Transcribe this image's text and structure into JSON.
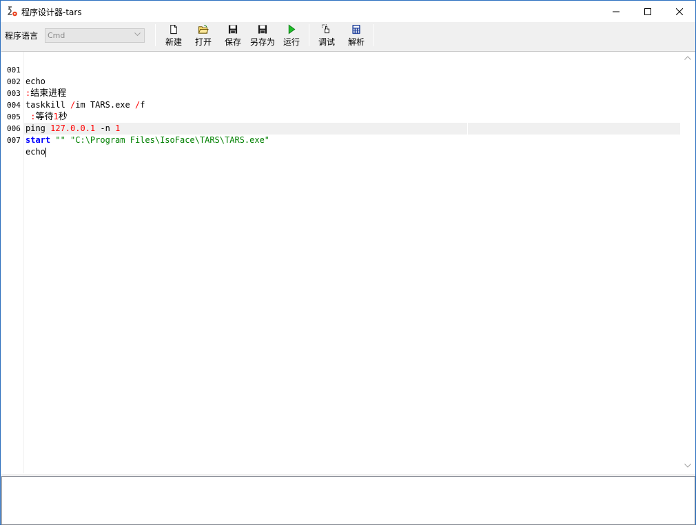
{
  "window": {
    "title": "程序设计器-tars",
    "app_icon": "gear-flow-icon",
    "controls": {
      "minimize": "minimize-icon",
      "maximize": "maximize-icon",
      "close": "close-icon"
    }
  },
  "toolbar": {
    "lang_label": "程序语言",
    "lang_value": "Cmd",
    "buttons": [
      {
        "label": "新建",
        "icon": "new-file-icon"
      },
      {
        "label": "打开",
        "icon": "open-folder-icon"
      },
      {
        "label": "保存",
        "icon": "save-icon"
      },
      {
        "label": "另存为",
        "icon": "save-as-icon"
      },
      {
        "label": "运行",
        "icon": "run-icon"
      },
      {
        "label": "调试",
        "icon": "debug-icon"
      },
      {
        "label": "解析",
        "icon": "calculator-icon"
      }
    ]
  },
  "editor": {
    "lines": [
      {
        "num": "001",
        "tokens": [
          {
            "t": "echo"
          }
        ]
      },
      {
        "num": "002",
        "tokens": [
          {
            "t": ":"
          },
          {
            "t": "结束进程"
          }
        ]
      },
      {
        "num": "003",
        "tokens": [
          {
            "t": "taskkill "
          },
          {
            "t": "/"
          },
          {
            "t": "im TARS.exe "
          },
          {
            "t": "/"
          },
          {
            "t": "f"
          }
        ]
      },
      {
        "num": "004",
        "tokens": [
          {
            "t": " :"
          },
          {
            "t": "等待"
          },
          {
            "t": "1"
          },
          {
            "t": "秒"
          }
        ]
      },
      {
        "num": "005",
        "tokens": [
          {
            "t": "ping "
          },
          {
            "t": "127.0.0.1"
          },
          {
            "t": " -n "
          },
          {
            "t": "1"
          }
        ]
      },
      {
        "num": "006",
        "tokens": [
          {
            "t": "start"
          },
          {
            "t": " \"\" "
          },
          {
            "t": "\"C:\\Program Files\\IsoFace\\TARS\\TARS.exe\""
          }
        ]
      },
      {
        "num": "007",
        "tokens": [
          {
            "t": "echo"
          }
        ]
      }
    ],
    "colors": {
      "keyword": "#0000ff",
      "operator": "#ff0000",
      "string": "#008000",
      "text": "#000000"
    }
  },
  "output": {
    "text": ""
  }
}
